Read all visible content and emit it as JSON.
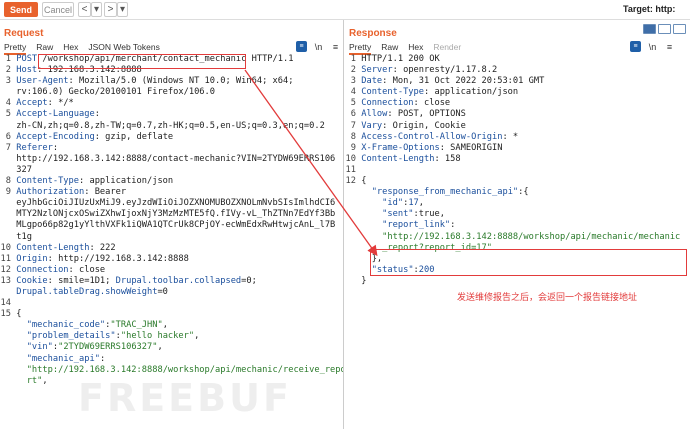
{
  "toolbar": {
    "send": "Send",
    "cancel": "Cancel",
    "back": "<",
    "back_menu": "▾",
    "forward": ">",
    "forward_menu": "▾",
    "target": "Target: http:"
  },
  "request": {
    "title": "Request",
    "tabs": [
      "Pretty",
      "Raw",
      "Hex",
      "JSON Web Tokens"
    ],
    "lines": [
      {
        "n": "1",
        "parts": [
          [
            "kw",
            "POST "
          ],
          [
            "v",
            "/workshop/api/merchant/contact_mechanic"
          ],
          [
            "v",
            " HTTP/1.1"
          ]
        ]
      },
      {
        "n": "2",
        "parts": [
          [
            "k",
            "Host"
          ],
          [
            "v",
            ": 192.168.3.142:8888"
          ]
        ]
      },
      {
        "n": "3",
        "parts": [
          [
            "k",
            "User-Agent"
          ],
          [
            "v",
            ": Mozilla/5.0 (Windows NT 10.0; Win64; x64;"
          ]
        ]
      },
      {
        "n": "",
        "parts": [
          [
            "v",
            "rv:106.0) Gecko/20100101 Firefox/106.0"
          ]
        ]
      },
      {
        "n": "4",
        "parts": [
          [
            "k",
            "Accept"
          ],
          [
            "v",
            ": */*"
          ]
        ]
      },
      {
        "n": "5",
        "parts": [
          [
            "k",
            "Accept-Language"
          ],
          [
            "v",
            ":"
          ]
        ]
      },
      {
        "n": "",
        "parts": [
          [
            "v",
            "zh-CN,zh;q=0.8,zh-TW;q=0.7,zh-HK;q=0.5,en-US;q=0.3,en;q=0.2"
          ]
        ]
      },
      {
        "n": "6",
        "parts": [
          [
            "k",
            "Accept-Encoding"
          ],
          [
            "v",
            ": gzip, deflate"
          ]
        ]
      },
      {
        "n": "7",
        "parts": [
          [
            "k",
            "Referer"
          ],
          [
            "v",
            ":"
          ]
        ]
      },
      {
        "n": "",
        "parts": [
          [
            "v",
            "http://192.168.3.142:8888/contact-mechanic?VIN=2TYDW69ERRS106"
          ]
        ]
      },
      {
        "n": "",
        "parts": [
          [
            "v",
            "327"
          ]
        ]
      },
      {
        "n": "8",
        "parts": [
          [
            "k",
            "Content-Type"
          ],
          [
            "v",
            ": application/json"
          ]
        ]
      },
      {
        "n": "9",
        "parts": [
          [
            "k",
            "Authorization"
          ],
          [
            "v",
            ": Bearer"
          ]
        ]
      },
      {
        "n": "",
        "parts": [
          [
            "v",
            "eyJhbGciOiJIUzUxMiJ9.eyJzdWIiOiJOZXNOMUBOZXNOLmNvbSIsImlhdCI6"
          ]
        ]
      },
      {
        "n": "",
        "parts": [
          [
            "v",
            "MTY2NzlONjcxOSwiZXhwIjoxNjY3MzMzMTE5fQ.fIVy-vL_ThZTNn7EdYf3Bb"
          ]
        ]
      },
      {
        "n": "",
        "parts": [
          [
            "v",
            "MLgpo66p82g1yYlthVXFk1iQWA1QTCrUk8CPjOY-ecWmEdxRwHtwjcAnL_l7B"
          ]
        ]
      },
      {
        "n": "",
        "parts": [
          [
            "v",
            "t1g"
          ]
        ]
      },
      {
        "n": "10",
        "parts": [
          [
            "k",
            "Content-Length"
          ],
          [
            "v",
            ": 222"
          ]
        ]
      },
      {
        "n": "11",
        "parts": [
          [
            "k",
            "Origin"
          ],
          [
            "v",
            ": http://192.168.3.142:8888"
          ]
        ]
      },
      {
        "n": "12",
        "parts": [
          [
            "k",
            "Connection"
          ],
          [
            "v",
            ": close"
          ]
        ]
      },
      {
        "n": "13",
        "parts": [
          [
            "k",
            "Cookie"
          ],
          [
            "v",
            ": smile=1D1; "
          ],
          [
            "k",
            "Drupal.toolbar.collapsed"
          ],
          [
            "v",
            "=0;"
          ]
        ]
      },
      {
        "n": "",
        "parts": [
          [
            "k",
            "Drupal.tableDrag.showWeight"
          ],
          [
            "v",
            "=0"
          ]
        ]
      },
      {
        "n": "14",
        "parts": [
          [
            "v",
            ""
          ]
        ]
      },
      {
        "n": "15",
        "parts": [
          [
            "v",
            "{"
          ]
        ]
      },
      {
        "n": "",
        "parts": [
          [
            "v",
            "  "
          ],
          [
            "jkey",
            "\"mechanic_code\""
          ],
          [
            "v",
            ":"
          ],
          [
            "str",
            "\"TRAC_JHN\""
          ],
          [
            "v",
            ","
          ]
        ]
      },
      {
        "n": "",
        "parts": [
          [
            "v",
            "  "
          ],
          [
            "jkey",
            "\"problem_details\""
          ],
          [
            "v",
            ":"
          ],
          [
            "str",
            "\"hello hacker\""
          ],
          [
            "v",
            ","
          ]
        ]
      },
      {
        "n": "",
        "parts": [
          [
            "v",
            "  "
          ],
          [
            "jkey",
            "\"vin\""
          ],
          [
            "v",
            ":"
          ],
          [
            "str",
            "\"2TYDW69ERRS106327\""
          ],
          [
            "v",
            ","
          ]
        ]
      },
      {
        "n": "",
        "parts": [
          [
            "v",
            "  "
          ],
          [
            "jkey",
            "\"mechanic_api\""
          ],
          [
            "v",
            ":"
          ]
        ]
      },
      {
        "n": "",
        "parts": [
          [
            "v",
            "  "
          ],
          [
            "str",
            "\"http://192.168.3.142:8888/workshop/api/mechanic/receive_repo"
          ]
        ]
      },
      {
        "n": "",
        "parts": [
          [
            "v",
            "  "
          ],
          [
            "str",
            "rt\""
          ],
          [
            "v",
            ","
          ]
        ]
      }
    ]
  },
  "response": {
    "title": "Response",
    "tabs": [
      "Pretty",
      "Raw",
      "Hex",
      "Render"
    ],
    "lines": [
      {
        "n": "1",
        "parts": [
          [
            "v",
            "HTTP/1.1 200 OK"
          ]
        ]
      },
      {
        "n": "2",
        "parts": [
          [
            "k",
            "Server"
          ],
          [
            "v",
            ": openresty/1.17.8.2"
          ]
        ]
      },
      {
        "n": "3",
        "parts": [
          [
            "k",
            "Date"
          ],
          [
            "v",
            ": Mon, 31 Oct 2022 20:53:01 GMT"
          ]
        ]
      },
      {
        "n": "4",
        "parts": [
          [
            "k",
            "Content-Type"
          ],
          [
            "v",
            ": application/json"
          ]
        ]
      },
      {
        "n": "5",
        "parts": [
          [
            "k",
            "Connection"
          ],
          [
            "v",
            ": close"
          ]
        ]
      },
      {
        "n": "6",
        "parts": [
          [
            "k",
            "Allow"
          ],
          [
            "v",
            ": POST, OPTIONS"
          ]
        ]
      },
      {
        "n": "7",
        "parts": [
          [
            "k",
            "Vary"
          ],
          [
            "v",
            ": Origin, Cookie"
          ]
        ]
      },
      {
        "n": "8",
        "parts": [
          [
            "k",
            "Access-Control-Allow-Origin"
          ],
          [
            "v",
            ": *"
          ]
        ]
      },
      {
        "n": "9",
        "parts": [
          [
            "k",
            "X-Frame-Options"
          ],
          [
            "v",
            ": SAMEORIGIN"
          ]
        ]
      },
      {
        "n": "10",
        "parts": [
          [
            "k",
            "Content-Length"
          ],
          [
            "v",
            ": 158"
          ]
        ]
      },
      {
        "n": "11",
        "parts": [
          [
            "v",
            ""
          ]
        ]
      },
      {
        "n": "12",
        "parts": [
          [
            "v",
            "{"
          ]
        ]
      },
      {
        "n": "",
        "parts": [
          [
            "v",
            "  "
          ],
          [
            "jkey",
            "\"response_from_mechanic_api\""
          ],
          [
            "v",
            ":{"
          ]
        ]
      },
      {
        "n": "",
        "parts": [
          [
            "v",
            "    "
          ],
          [
            "jkey",
            "\"id\""
          ],
          [
            "v",
            ":"
          ],
          [
            "num",
            "17"
          ],
          [
            "v",
            ","
          ]
        ]
      },
      {
        "n": "",
        "parts": [
          [
            "v",
            "    "
          ],
          [
            "jkey",
            "\"sent\""
          ],
          [
            "v",
            ":true,"
          ]
        ]
      },
      {
        "n": "",
        "parts": [
          [
            "v",
            "    "
          ],
          [
            "jkey",
            "\"report_link\""
          ],
          [
            "v",
            ":"
          ]
        ]
      },
      {
        "n": "",
        "parts": [
          [
            "v",
            "    "
          ],
          [
            "str",
            "\"http://192.168.3.142:8888/workshop/api/mechanic/mechanic"
          ]
        ]
      },
      {
        "n": "",
        "parts": [
          [
            "v",
            "    "
          ],
          [
            "str",
            "_report?report_id=17\""
          ]
        ]
      },
      {
        "n": "",
        "parts": [
          [
            "v",
            "  },"
          ]
        ]
      },
      {
        "n": "",
        "parts": [
          [
            "v",
            "  "
          ],
          [
            "jkey",
            "\"status\""
          ],
          [
            "v",
            ":"
          ],
          [
            "num",
            "200"
          ]
        ]
      },
      {
        "n": "",
        "parts": [
          [
            "v",
            "}"
          ]
        ]
      }
    ]
  },
  "annotation": "发送维修报告之后，会返回一个报告链接地址",
  "watermark": "FREEBUF",
  "colors": {
    "accent": "#e8622d",
    "highlight": "#e23b3b",
    "key": "#1b4f9c",
    "string": "#2a7a2a"
  }
}
